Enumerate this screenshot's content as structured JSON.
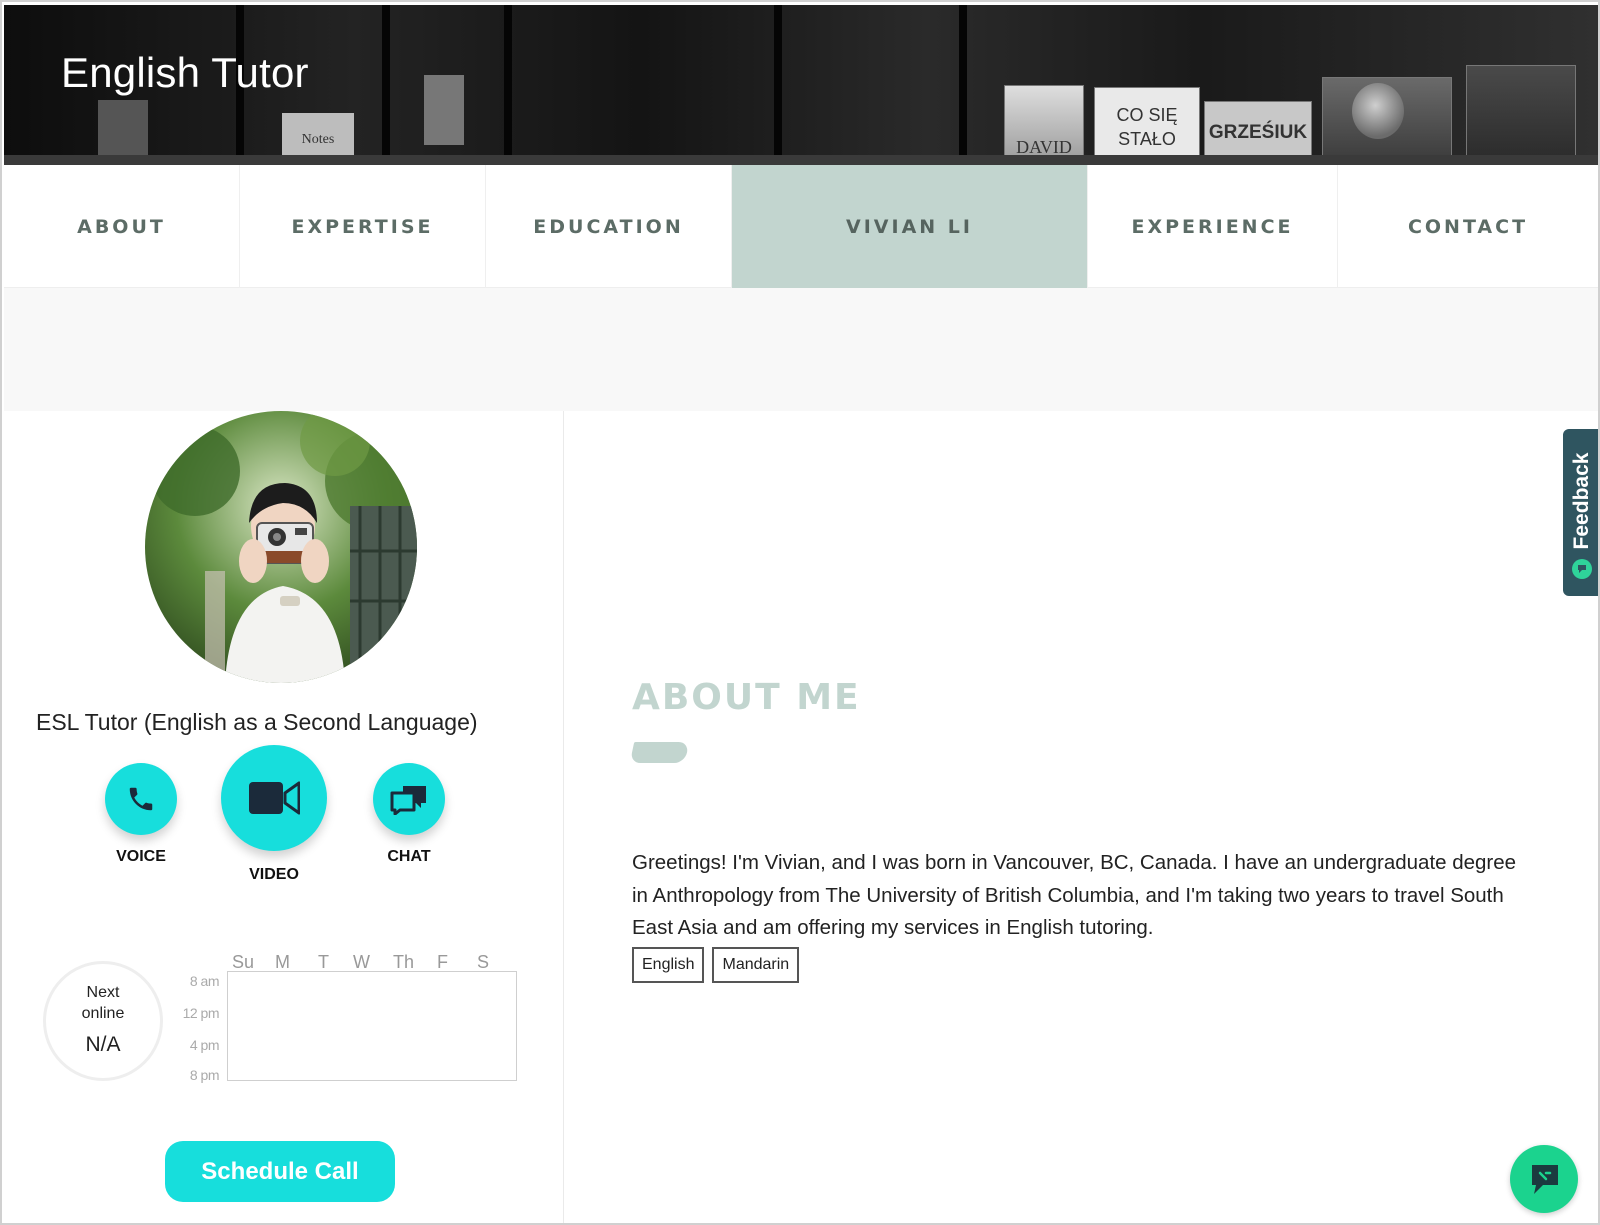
{
  "header": {
    "brand_title": "English Tutor",
    "banner_book_text_1": "CO SIĘ",
    "banner_book_text_2": "STAŁO",
    "banner_book_text_3": "GRZEŚIUK",
    "banner_book_text_4": "DAVID",
    "banner_note_text": "Notes"
  },
  "nav": {
    "items": [
      {
        "label": "ABOUT"
      },
      {
        "label": "EXPERTISE"
      },
      {
        "label": "EDUCATION"
      },
      {
        "label": "VIVIAN LI"
      },
      {
        "label": "EXPERIENCE"
      },
      {
        "label": "CONTACT"
      }
    ],
    "active_index": 3
  },
  "profile": {
    "title": "ESL Tutor (English as a Second Language)",
    "actions": {
      "voice_label": "VOICE",
      "video_label": "VIDEO",
      "chat_label": "CHAT"
    },
    "availability": {
      "next_online_label": "Next online",
      "next_online_value": "N/A",
      "days": [
        "Su",
        "M",
        "T",
        "W",
        "Th",
        "F",
        "S"
      ],
      "times": [
        "8 am",
        "12 pm",
        "4 pm",
        "8 pm"
      ]
    },
    "schedule_button": "Schedule Call"
  },
  "about": {
    "heading": "ABOUT ME",
    "text": "Greetings! I'm Vivian, and I was born in Vancouver, BC, Canada. I have an undergraduate degree in Anthropology from The University of British Columbia, and I'm taking two years to travel South East Asia and am offering my services in English tutoring.",
    "languages": [
      "English",
      "Mandarin"
    ]
  },
  "widgets": {
    "feedback_label": "Feedback"
  },
  "colors": {
    "accent": "#17dedc",
    "nav_active": "#c2d5cf",
    "nav_text": "#5c6c66",
    "feedback_bg": "#2f5560",
    "chat_fab": "#1bd38e"
  },
  "icons": [
    "phone-icon",
    "video-camera-icon",
    "chat-bubbles-icon",
    "feedback-icon",
    "chat-widget-icon"
  ]
}
